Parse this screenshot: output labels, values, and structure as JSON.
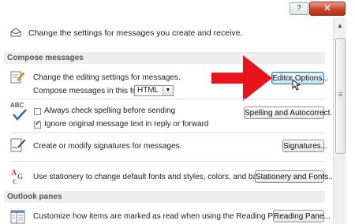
{
  "titlebar": {
    "help_label": "?",
    "close_label": "✕"
  },
  "intro": {
    "text": "Change the settings for messages you create and receive."
  },
  "compose": {
    "header": "Compose messages",
    "editing_text": "Change the editing settings for messages.",
    "format_label": "Compose messages in this format:",
    "format_value": "HTML",
    "editor_button": "Editor Options...",
    "spell_always": "Always check spelling before sending",
    "spell_always_checked": false,
    "ignore_original": "Ignore original message text in reply or forward",
    "ignore_original_checked": true,
    "spelling_button": "Spelling and Autocorrect...",
    "signatures_text": "Create or modify signatures for messages.",
    "signatures_button": "Signatures...",
    "stationery_text": "Use stationery to change default fonts and styles, colors, and backgrounds.",
    "stationery_button": "Stationery and Fonts...",
    "abc_icon_text": "ABC"
  },
  "panes": {
    "header": "Outlook panes",
    "reading_text": "Customize how items are marked as read when using the Reading Pane.",
    "reading_button": "Reading Pane..."
  },
  "annotation": {
    "arrow_color": "#e8141c"
  },
  "colors": {
    "header_bg": "#eeeeee",
    "focus_border": "#3c7fb1"
  }
}
